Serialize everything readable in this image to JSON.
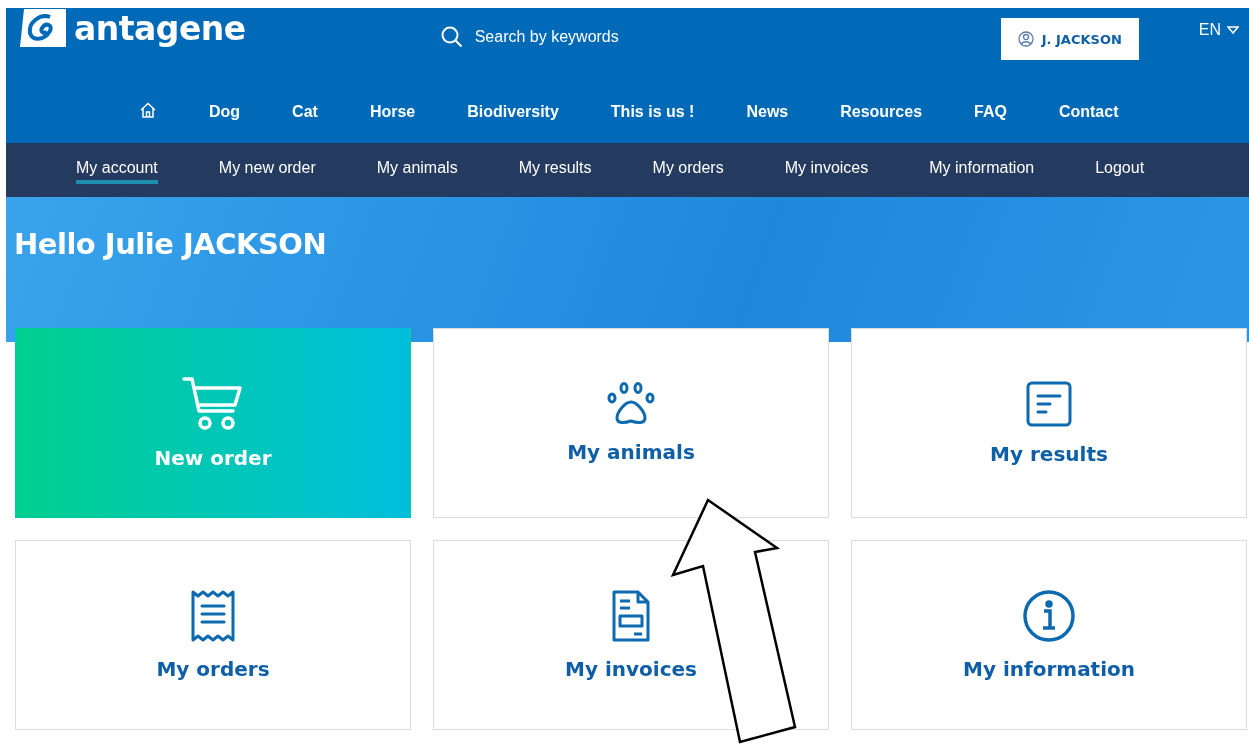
{
  "header": {
    "logo": "antagene",
    "search": {
      "placeholder": "Search by keywords"
    },
    "user_button": "J. JACKSON",
    "language": "EN"
  },
  "main_nav": [
    {
      "kind": "home"
    },
    {
      "label": "Dog"
    },
    {
      "label": "Cat"
    },
    {
      "label": "Horse"
    },
    {
      "label": "Biodiversity"
    },
    {
      "label": "This is us !"
    },
    {
      "label": "News"
    },
    {
      "label": "Resources"
    },
    {
      "label": "FAQ"
    },
    {
      "label": "Contact"
    }
  ],
  "account_nav": [
    {
      "label": "My account",
      "selected": true
    },
    {
      "label": "My new order",
      "selected": false
    },
    {
      "label": "My animals",
      "selected": false
    },
    {
      "label": "My results",
      "selected": false
    },
    {
      "label": "My orders",
      "selected": false
    },
    {
      "label": "My invoices",
      "selected": false
    },
    {
      "label": "My information",
      "selected": false
    },
    {
      "label": "Logout",
      "selected": false
    }
  ],
  "greeting": "Hello Julie JACKSON",
  "cards": [
    {
      "kind": "cart",
      "label": "New order",
      "highlighted": true
    },
    {
      "kind": "paw",
      "label": "My animals",
      "highlighted": false
    },
    {
      "kind": "results",
      "label": "My results",
      "highlighted": false
    },
    {
      "kind": "receipt",
      "label": "My orders",
      "highlighted": false
    },
    {
      "kind": "invoice",
      "label": "My invoices",
      "highlighted": false
    },
    {
      "kind": "info",
      "label": "My information",
      "highlighted": false
    }
  ]
}
